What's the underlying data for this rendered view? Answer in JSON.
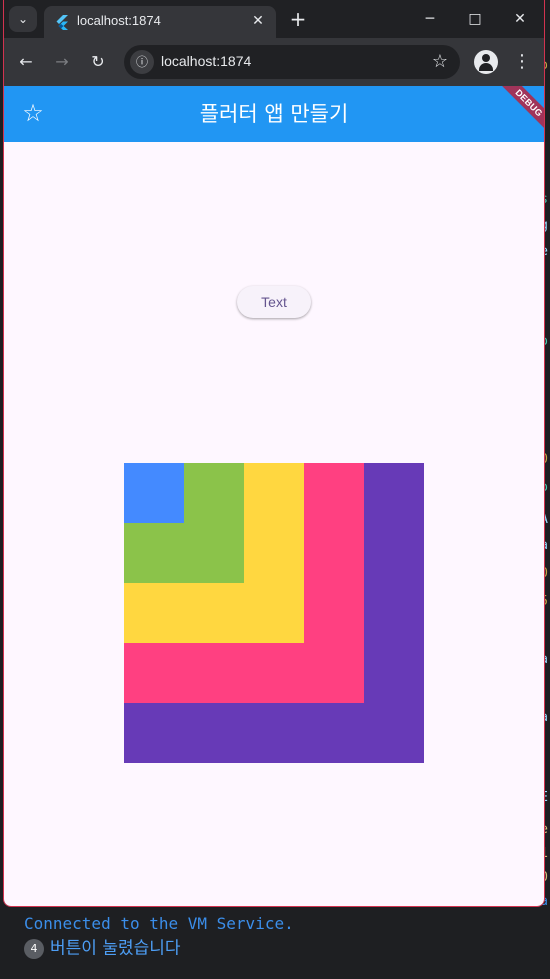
{
  "browser": {
    "tab_title": "localhost:1874",
    "url": "localhost:1874",
    "icons": {
      "tab_list": "chevron-down-icon",
      "favicon": "flutter-icon",
      "tab_close": "close-icon",
      "new_tab": "plus-icon",
      "minimize": "minimize-icon",
      "maximize": "maximize-icon",
      "close": "close-icon",
      "back": "arrow-left-icon",
      "forward": "arrow-right-icon",
      "reload": "reload-icon",
      "site_info": "info-icon",
      "bookmark": "star-outline-icon",
      "profile": "profile-icon",
      "menu": "more-vertical-icon"
    }
  },
  "app": {
    "title": "플러터 앱 만들기",
    "leading_icon": "star-outline-icon",
    "debug_banner": "DEBUG",
    "button_label": "Text",
    "appbar_color": "#2196f3",
    "background_color": "#fef7ff",
    "nested_boxes": [
      {
        "color": "#673ab7",
        "fraction": 1.0
      },
      {
        "color": "#ff4081",
        "fraction": 0.8
      },
      {
        "color": "#ffd740",
        "fraction": 0.6
      },
      {
        "color": "#8bc34a",
        "fraction": 0.4
      },
      {
        "color": "#448aff",
        "fraction": 0.2
      }
    ]
  },
  "console": {
    "line1": "Connected to the VM Service.",
    "count": "4",
    "message": "버튼이 눌렸습니다"
  }
}
